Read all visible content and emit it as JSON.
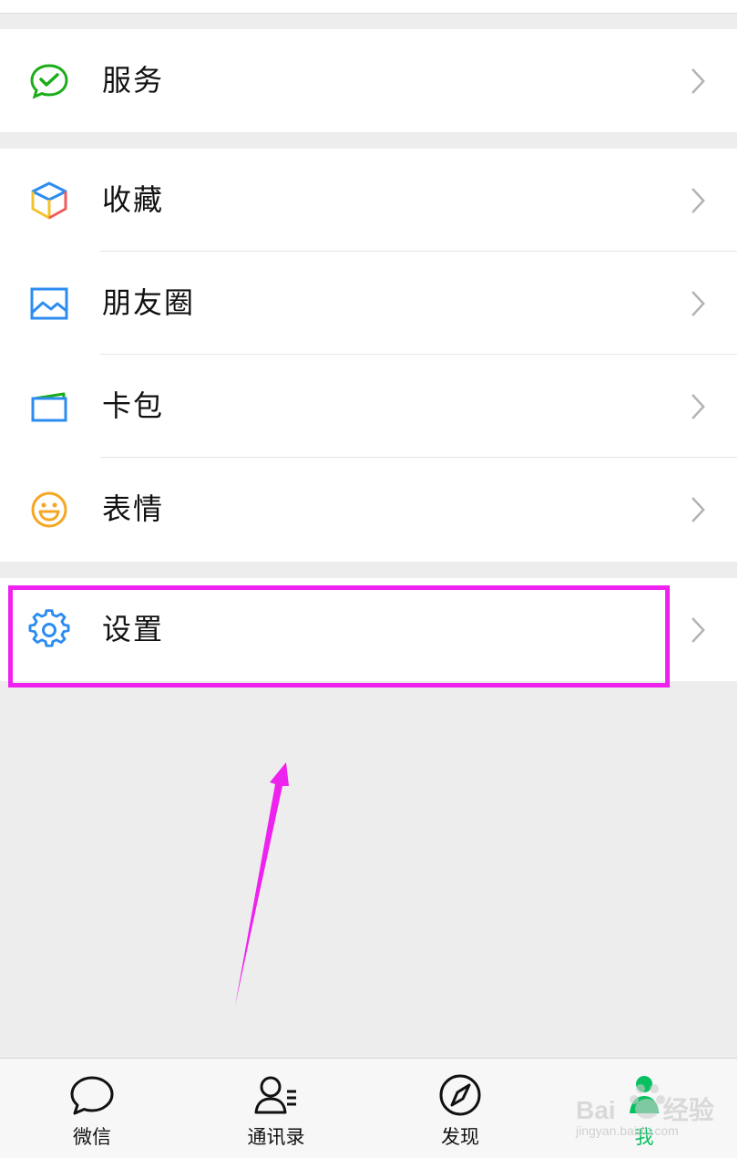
{
  "menu": {
    "service_label": "服务",
    "favorites_label": "收藏",
    "moments_label": "朋友圈",
    "cards_label": "卡包",
    "stickers_label": "表情",
    "settings_label": "设置"
  },
  "tabbar": {
    "chats_label": "微信",
    "contacts_label": "通讯录",
    "discover_label": "发现",
    "me_label": "我",
    "active_color": "#07c160"
  },
  "watermark": {
    "brand": "Bai",
    "brand_suffix": "经验",
    "url": "jingyan.baidu.com"
  },
  "colors": {
    "highlight": "#ee22ee",
    "arrow": "#ee22ee",
    "background": "#ededed"
  }
}
